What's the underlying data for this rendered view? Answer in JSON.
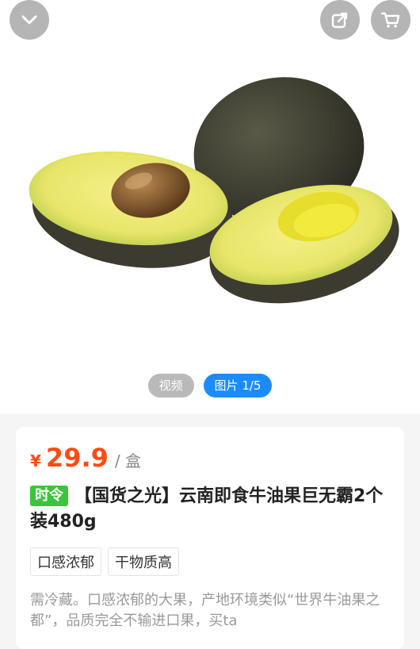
{
  "nav": {
    "back_icon": "chevron-down-icon",
    "share_icon": "share-icon",
    "cart_icon": "cart-icon"
  },
  "media": {
    "video_label": "视频",
    "photo_label": "图片 1/5",
    "active_color": "#1a8cff"
  },
  "product": {
    "price_symbol": "¥",
    "price": "29.9",
    "unit": "/ 盒",
    "season_tag": "时令",
    "title": "【国货之光】云南即食牛油果巨无霸2个装480g",
    "features": [
      "口感浓郁",
      "干物质高"
    ],
    "description": "需冷藏。口感浓郁的大果，产地环境类似“世界牛油果之都”，品质完全不输进口果，买ta",
    "price_color": "#ff4b12",
    "tag_color": "#3cc43c"
  }
}
